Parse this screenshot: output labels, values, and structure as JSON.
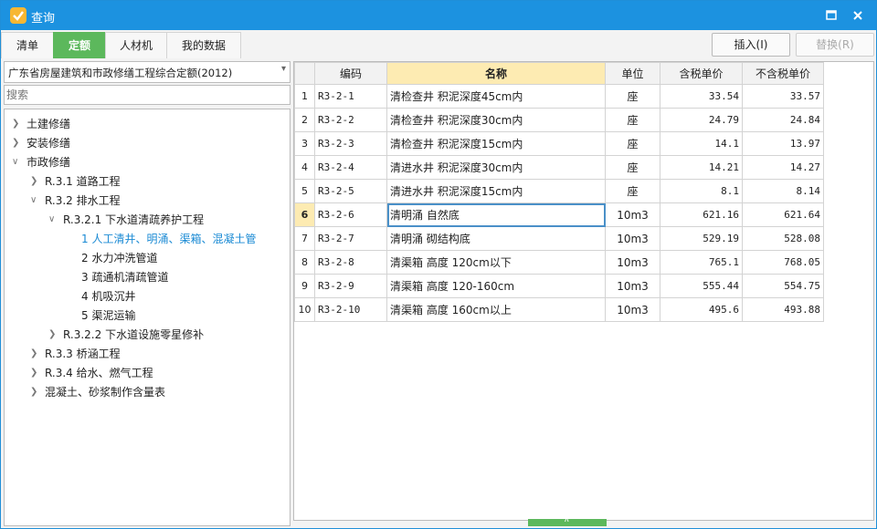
{
  "window": {
    "title": "查询"
  },
  "tabs": [
    {
      "label": "清单"
    },
    {
      "label": "定额"
    },
    {
      "label": "人材机"
    },
    {
      "label": "我的数据"
    }
  ],
  "toolbar": {
    "insert_label": "插入(I)",
    "replace_label": "替换(R)"
  },
  "quota_selector": {
    "value": "广东省房屋建筑和市政修缮工程综合定额(2012)"
  },
  "search": {
    "placeholder": "搜索"
  },
  "tree": [
    {
      "label": "土建修缮"
    },
    {
      "label": "安装修缮"
    },
    {
      "label": "市政修缮"
    },
    {
      "label": "R.3.1 道路工程"
    },
    {
      "label": "R.3.2 排水工程"
    },
    {
      "label": "R.3.2.1 下水道清疏养护工程"
    },
    {
      "label": "1 人工清井、明涌、渠箱、混凝土管"
    },
    {
      "label": "2 水力冲洗管道"
    },
    {
      "label": "3 疏通机清疏管道"
    },
    {
      "label": "4 机吸沉井"
    },
    {
      "label": "5 渠泥运输"
    },
    {
      "label": "R.3.2.2 下水道设施零星修补"
    },
    {
      "label": "R.3.3 桥涵工程"
    },
    {
      "label": "R.3.4 给水、燃气工程"
    },
    {
      "label": "混凝土、砂浆制作含量表"
    }
  ],
  "table": {
    "headers": [
      "",
      "编码",
      "名称",
      "单位",
      "含税单价",
      "不含税单价"
    ],
    "rows": [
      [
        "1",
        "R3-2-1",
        "清检查井 积泥深度45cm内",
        "座",
        "33.54",
        "33.57"
      ],
      [
        "2",
        "R3-2-2",
        "清检查井 积泥深度30cm内",
        "座",
        "24.79",
        "24.84"
      ],
      [
        "3",
        "R3-2-3",
        "清检查井 积泥深度15cm内",
        "座",
        "14.1",
        "13.97"
      ],
      [
        "4",
        "R3-2-4",
        "清进水井 积泥深度30cm内",
        "座",
        "14.21",
        "14.27"
      ],
      [
        "5",
        "R3-2-5",
        "清进水井 积泥深度15cm内",
        "座",
        "8.1",
        "8.14"
      ],
      [
        "6",
        "R3-2-6",
        "清明涌 自然底",
        "10m3",
        "621.16",
        "621.64"
      ],
      [
        "7",
        "R3-2-7",
        "清明涌 砌结构底",
        "10m3",
        "529.19",
        "528.08"
      ],
      [
        "8",
        "R3-2-8",
        "清渠箱 高度 120cm以下",
        "10m3",
        "765.1",
        "768.05"
      ],
      [
        "9",
        "R3-2-9",
        "清渠箱 高度 120-160cm",
        "10m3",
        "555.44",
        "554.75"
      ],
      [
        "10",
        "R3-2-10",
        "清渠箱 高度 160cm以上",
        "10m3",
        "495.6",
        "493.88"
      ]
    ]
  },
  "colors": {
    "titlebar": "#1c92e0",
    "active_tab": "#5cb85c",
    "highlight": "#fdebb2",
    "selected_text": "#1a8ad4"
  },
  "icons": {
    "maximize": "maximize-icon",
    "close": "close-icon",
    "expand": "chevron-right-icon",
    "collapse": "chevron-down-icon"
  }
}
